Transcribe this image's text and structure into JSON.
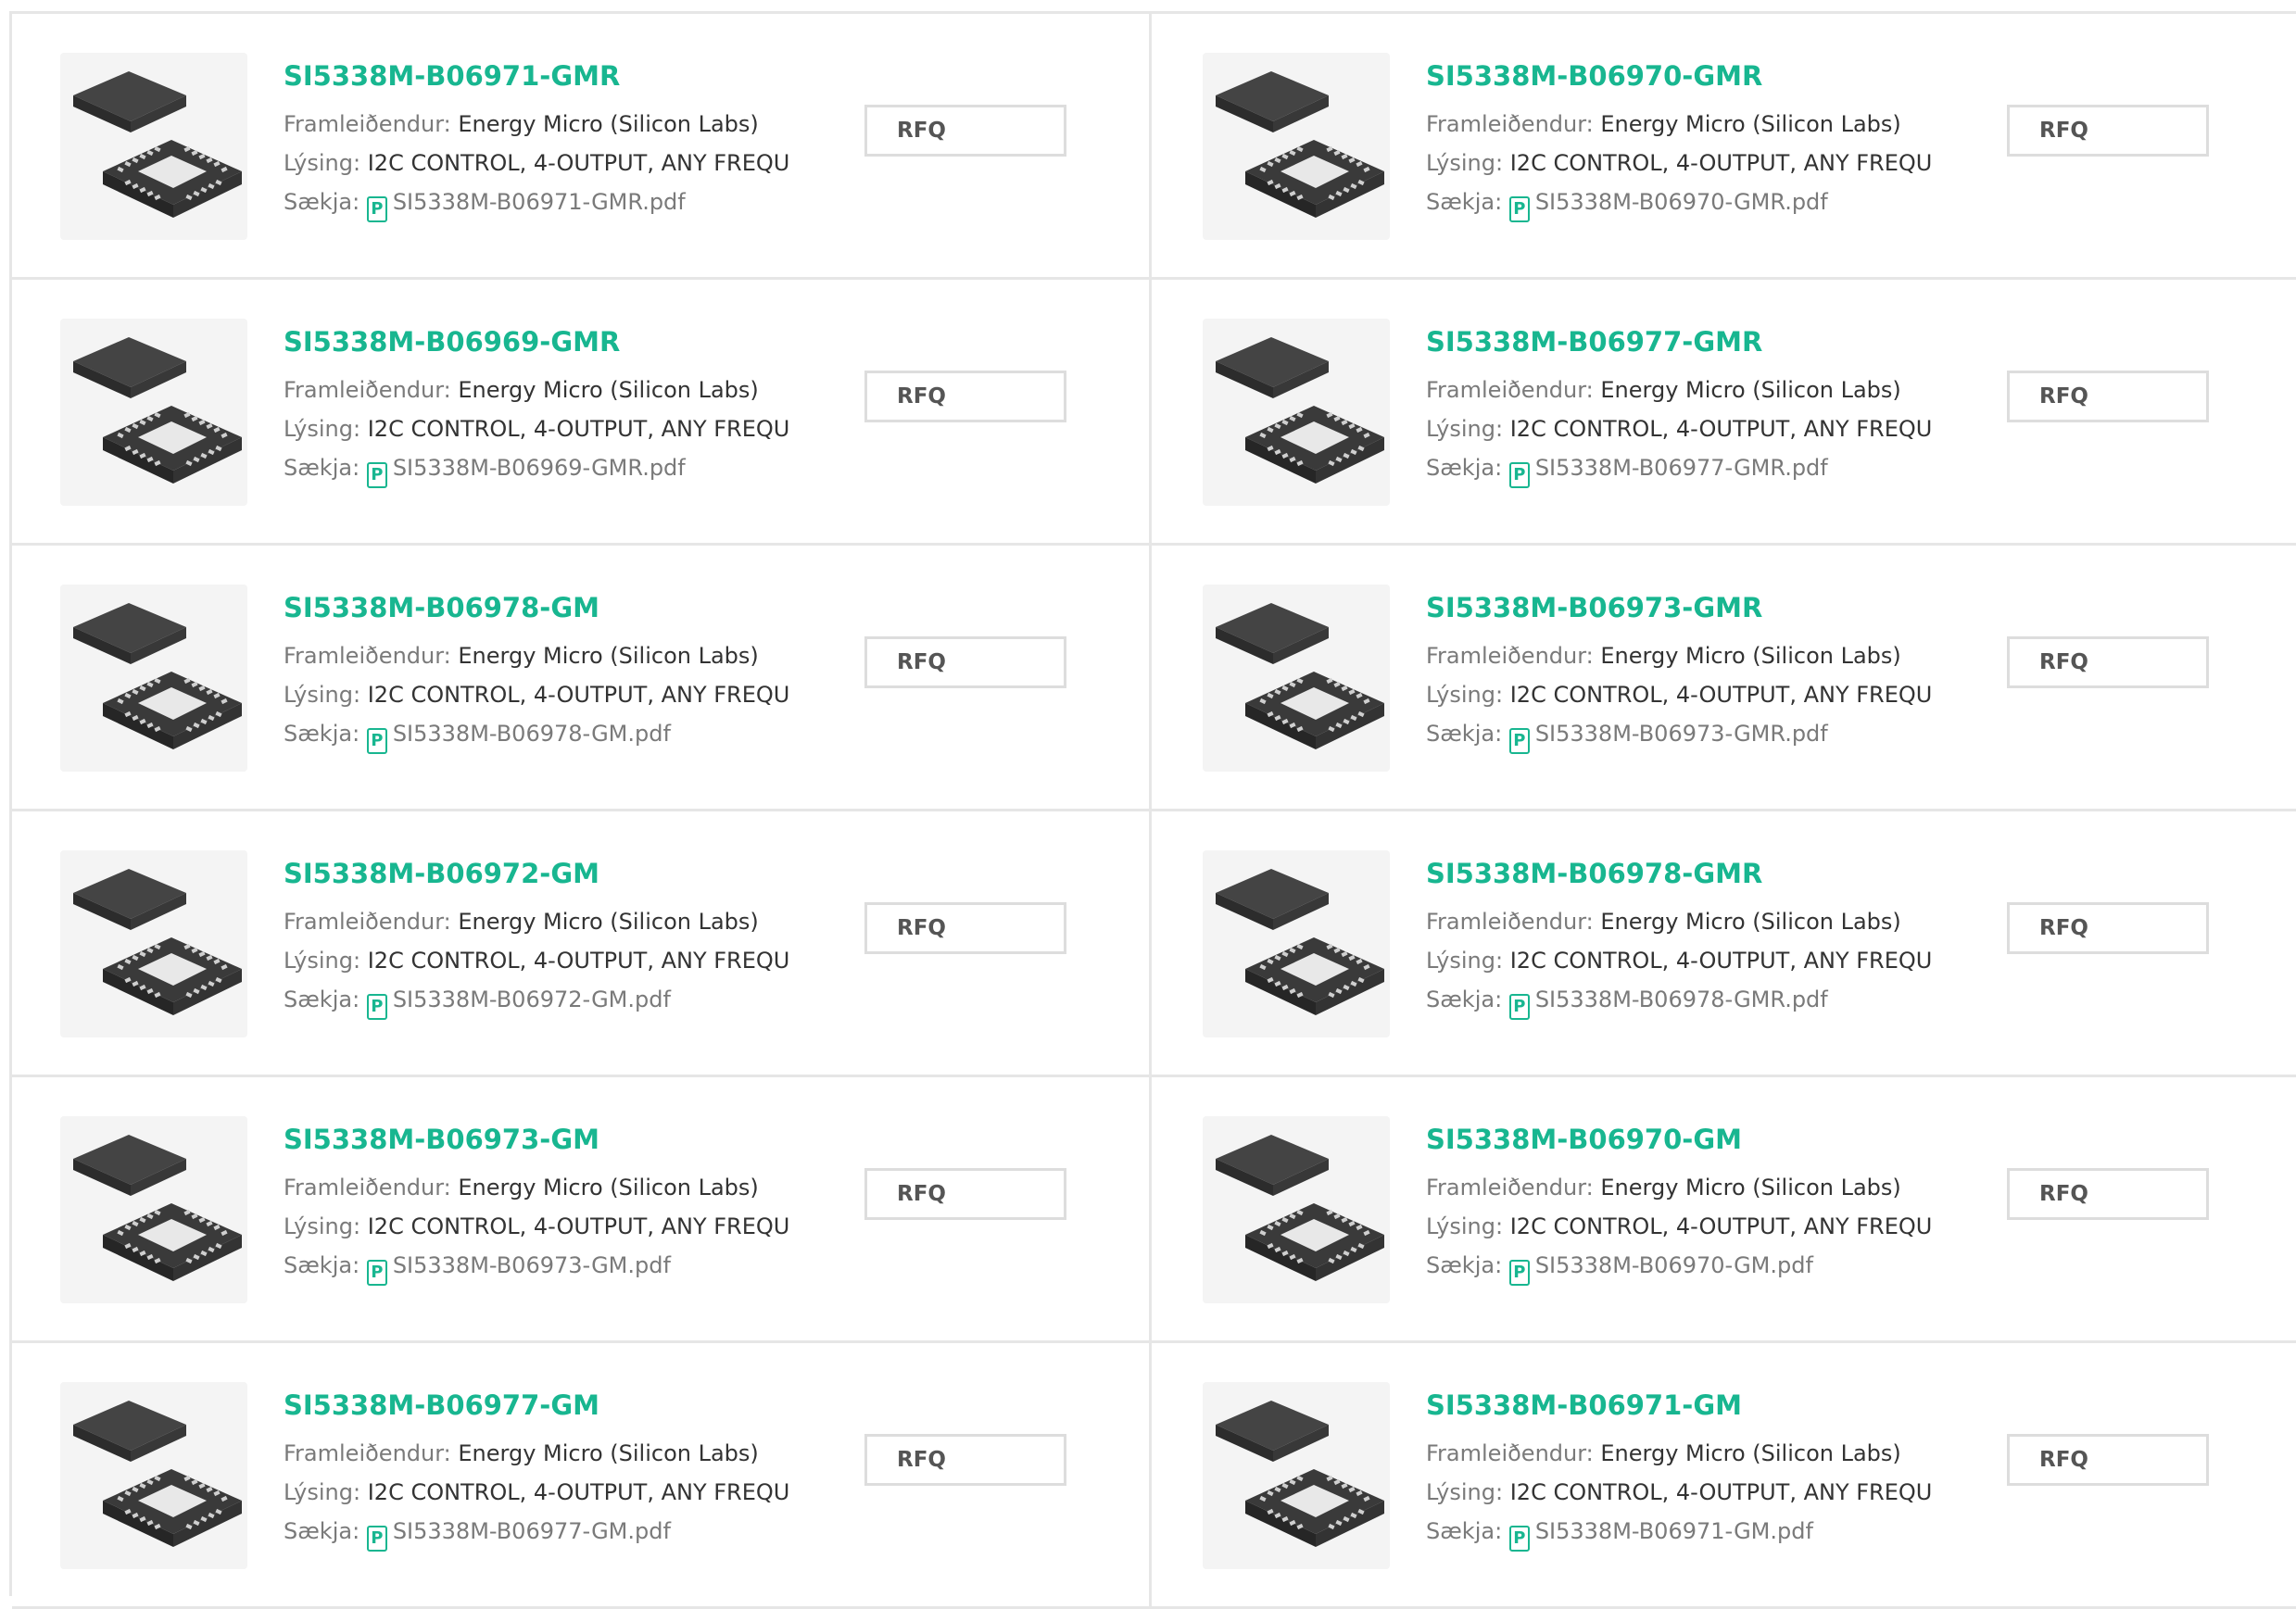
{
  "labels": {
    "manufacturer": "Framleiðendur:",
    "description": "Lýsing:",
    "download": "Sækja:",
    "rfq": "RFQ",
    "pdf_icon": "P"
  },
  "icons": {
    "pdf": "pdf-file-icon",
    "chip": "qfn-chip-image"
  },
  "colors": {
    "accent": "#18b690",
    "border": "#e6e6e6",
    "label": "#7a7a7a",
    "text": "#333333"
  },
  "products": [
    {
      "name": "SI5338M-B06971-GMR",
      "manufacturer": "Energy Micro (Silicon Labs)",
      "description": "I2C CONTROL, 4-OUTPUT, ANY FREQU",
      "pdf": "SI5338M-B06971-GMR.pdf"
    },
    {
      "name": "SI5338M-B06970-GMR",
      "manufacturer": "Energy Micro (Silicon Labs)",
      "description": "I2C CONTROL, 4-OUTPUT, ANY FREQU",
      "pdf": "SI5338M-B06970-GMR.pdf"
    },
    {
      "name": "SI5338M-B06969-GMR",
      "manufacturer": "Energy Micro (Silicon Labs)",
      "description": "I2C CONTROL, 4-OUTPUT, ANY FREQU",
      "pdf": "SI5338M-B06969-GMR.pdf"
    },
    {
      "name": "SI5338M-B06977-GMR",
      "manufacturer": "Energy Micro (Silicon Labs)",
      "description": "I2C CONTROL, 4-OUTPUT, ANY FREQU",
      "pdf": "SI5338M-B06977-GMR.pdf"
    },
    {
      "name": "SI5338M-B06978-GM",
      "manufacturer": "Energy Micro (Silicon Labs)",
      "description": "I2C CONTROL, 4-OUTPUT, ANY FREQU",
      "pdf": "SI5338M-B06978-GM.pdf"
    },
    {
      "name": "SI5338M-B06973-GMR",
      "manufacturer": "Energy Micro (Silicon Labs)",
      "description": "I2C CONTROL, 4-OUTPUT, ANY FREQU",
      "pdf": "SI5338M-B06973-GMR.pdf"
    },
    {
      "name": "SI5338M-B06972-GM",
      "manufacturer": "Energy Micro (Silicon Labs)",
      "description": "I2C CONTROL, 4-OUTPUT, ANY FREQU",
      "pdf": "SI5338M-B06972-GM.pdf"
    },
    {
      "name": "SI5338M-B06978-GMR",
      "manufacturer": "Energy Micro (Silicon Labs)",
      "description": "I2C CONTROL, 4-OUTPUT, ANY FREQU",
      "pdf": "SI5338M-B06978-GMR.pdf"
    },
    {
      "name": "SI5338M-B06973-GM",
      "manufacturer": "Energy Micro (Silicon Labs)",
      "description": "I2C CONTROL, 4-OUTPUT, ANY FREQU",
      "pdf": "SI5338M-B06973-GM.pdf"
    },
    {
      "name": "SI5338M-B06970-GM",
      "manufacturer": "Energy Micro (Silicon Labs)",
      "description": "I2C CONTROL, 4-OUTPUT, ANY FREQU",
      "pdf": "SI5338M-B06970-GM.pdf"
    },
    {
      "name": "SI5338M-B06977-GM",
      "manufacturer": "Energy Micro (Silicon Labs)",
      "description": "I2C CONTROL, 4-OUTPUT, ANY FREQU",
      "pdf": "SI5338M-B06977-GM.pdf"
    },
    {
      "name": "SI5338M-B06971-GM",
      "manufacturer": "Energy Micro (Silicon Labs)",
      "description": "I2C CONTROL, 4-OUTPUT, ANY FREQU",
      "pdf": "SI5338M-B06971-GM.pdf"
    }
  ]
}
